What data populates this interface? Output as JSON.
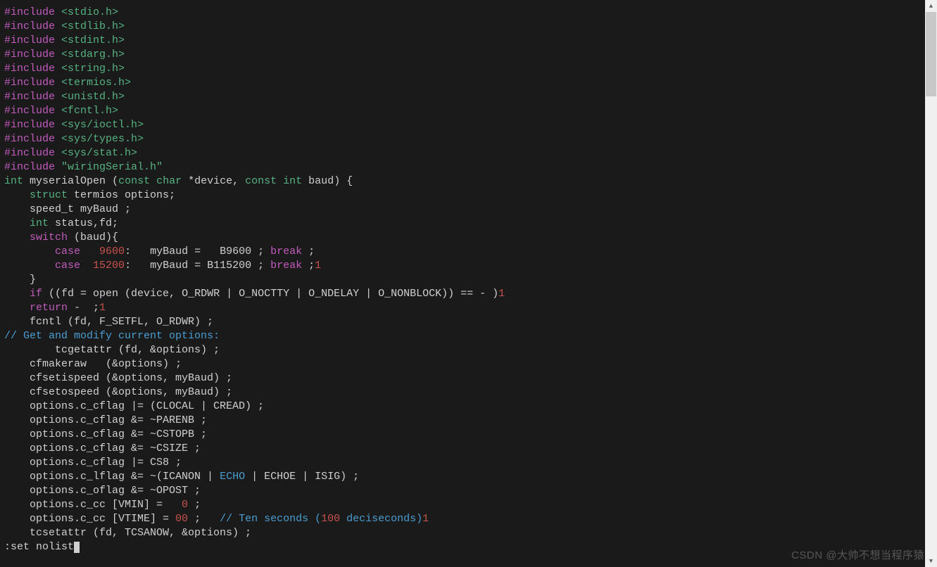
{
  "includes": {
    "directive": "#include",
    "sys": [
      "<stdio.h>",
      "<stdlib.h>",
      "<stdint.h>",
      "<stdarg.h>",
      "<string.h>",
      "<termios.h>",
      "<unistd.h>",
      "<fcntl.h>",
      "<sys/ioctl.h>",
      "<sys/types.h>",
      "<sys/stat.h>"
    ],
    "local": "\"wiringSerial.h\""
  },
  "func": {
    "ret": "int",
    "name": "myserialOpen",
    "p1_q": "const char",
    "p1_n": "*device",
    "p2_q": "const int",
    "p2_n": "baud",
    "brace_open": "{",
    "brace_close": "}"
  },
  "body": {
    "struct_kw": "struct",
    "struct_line": " termios options;",
    "speed_line": "    speed_t myBaud ;",
    "int_kw": "int",
    "status_line": " status,fd;",
    "switch_kw": "switch",
    "switch_arg": " (baud){",
    "case_kw": "case",
    "case1_val": "9600",
    "case1_mid": ":   myBaud =   B9600 ; ",
    "case2_val": "15200",
    "case2_mid": ":   myBaud = B115200 ; ",
    "break_kw": "break",
    "semi": " ;",
    "tail1": "1",
    "if_kw": "if",
    "if_body": " ((fd = open (device, O_RDWR | O_NOCTTY | O_NDELAY | O_NONBLOCK)) == - )",
    "return_kw": "return",
    "return_tail": " -  ;",
    "fcntl": "    fcntl (fd, F_SETFL, O_RDWR) ;",
    "cmt1": "// Get and modify current options:",
    "tcget": "        tcgetattr (fd, &options) ;",
    "cfmakeraw": "    cfmakeraw   (&options) ;",
    "cfi": "    cfsetispeed (&options, myBaud) ;",
    "cfo": "    cfsetospeed (&options, myBaud) ;",
    "o1": "    options.c_cflag |= (CLOCAL | CREAD) ;",
    "o2": "    options.c_cflag &= ~PARENB ;",
    "o3": "    options.c_cflag &= ~CSTOPB ;",
    "o4": "    options.c_cflag &= ~CSIZE ;",
    "o5": "    options.c_cflag |= CS8 ;",
    "o6a": "    options.c_lflag &= ~(ICANON | ",
    "o6_echo": "ECHO",
    "o6b": " | ECHOE | ISIG) ;",
    "o7": "    options.c_oflag &= ~OPOST ;",
    "vmin_a": "    options.c_cc [VMIN] =   ",
    "vmin_n": "0",
    "vmin_b": " ;",
    "vtime_a": "    options.c_cc [VTIME] = ",
    "vtime_n": "00",
    "vtime_b": " ;   ",
    "vtime_cmt_a": "// Ten seconds (",
    "vtime_cmt_n": "100",
    "vtime_cmt_b": " deciseconds)",
    "tcset": "    tcsetattr (fd, TCSANOW, &options) ;"
  },
  "cmdline": ":set nolist",
  "watermark": "CSDN @大帅不想当程序猿"
}
